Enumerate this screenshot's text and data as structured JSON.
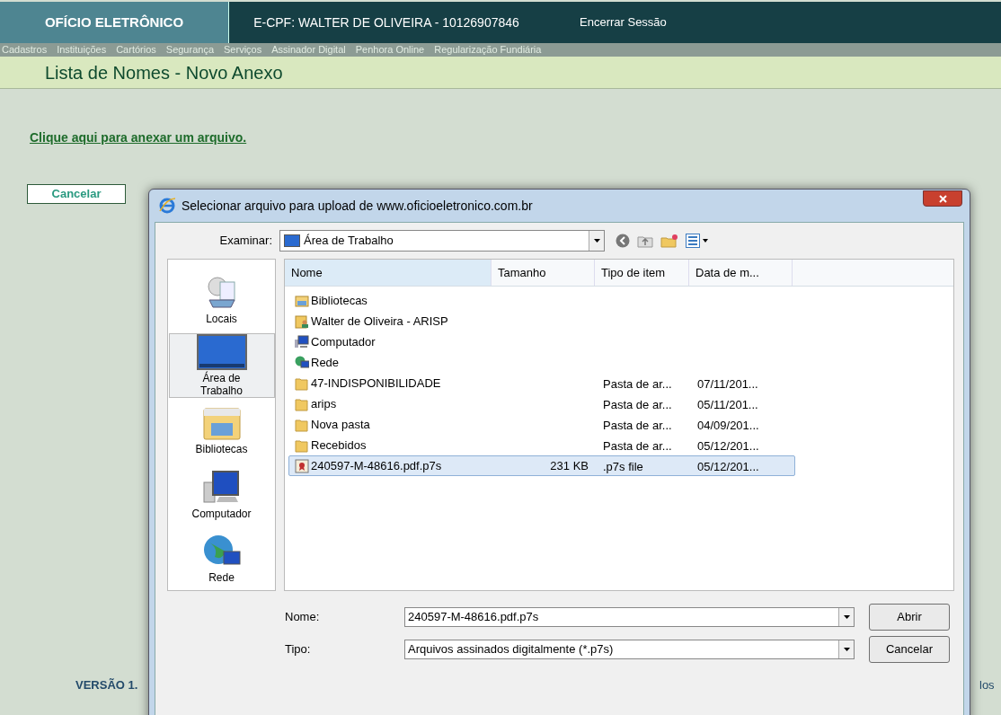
{
  "header": {
    "brand": "OFÍCIO ELETRÔNICO",
    "user": "E-CPF: WALTER DE OLIVEIRA - 10126907846",
    "logout": "Encerrar Sessão"
  },
  "menu": [
    "Cadastros",
    "Instituições",
    "Cartórios",
    "Segurança",
    "Serviços",
    "Assinador Digital",
    "Penhora Online",
    "Regularização Fundiária"
  ],
  "page_title": "Lista de Nomes - Novo Anexo",
  "attach_link": "Clique aqui para anexar um arquivo.",
  "cancel_button": "Cancelar",
  "footer": {
    "version": "VERSÃO 1.",
    "right_text": "los"
  },
  "dialog": {
    "title": "Selecionar arquivo para upload de www.oficioeletronico.com.br",
    "look_in_label": "Examinar:",
    "look_in_value": "Área de Trabalho",
    "places": [
      {
        "label": "Locais",
        "kind": "recent",
        "selected": false
      },
      {
        "label": "Área de Trabalho",
        "kind": "desktop",
        "selected": true
      },
      {
        "label": "Bibliotecas",
        "kind": "library",
        "selected": false
      },
      {
        "label": "Computador",
        "kind": "computer",
        "selected": false
      },
      {
        "label": "Rede",
        "kind": "network",
        "selected": false
      }
    ],
    "columns": [
      "Nome",
      "Tamanho",
      "Tipo de item",
      "Data de m..."
    ],
    "files": [
      {
        "name": "Bibliotecas",
        "kind": "library",
        "selected": false
      },
      {
        "name": "Walter de Oliveira - ARISP",
        "kind": "user",
        "selected": false
      },
      {
        "name": "Computador",
        "kind": "computer",
        "selected": false
      },
      {
        "name": "Rede",
        "kind": "network",
        "selected": false
      },
      {
        "name": "47-INDISPONIBILIDADE",
        "type": "Pasta de ar...",
        "date": "07/11/201...",
        "kind": "folder",
        "selected": false
      },
      {
        "name": "arips",
        "type": "Pasta de ar...",
        "date": "05/11/201...",
        "kind": "folder",
        "selected": false
      },
      {
        "name": "Nova pasta",
        "type": "Pasta de ar...",
        "date": "04/09/201...",
        "kind": "folder",
        "selected": false
      },
      {
        "name": "Recebidos",
        "type": "Pasta de ar...",
        "date": "05/12/201...",
        "kind": "folder",
        "selected": false
      },
      {
        "name": "240597-M-48616.pdf.p7s",
        "size": "231 KB",
        "type": ".p7s file",
        "date": "05/12/201...",
        "kind": "certificate",
        "selected": true
      }
    ],
    "filename_label": "Nome:",
    "filename_value": "240597-M-48616.pdf.p7s",
    "filetype_label": "Tipo:",
    "filetype_value": "Arquivos assinados digitalmente (*.p7s)",
    "buttons": [
      "Abrir",
      "Cancelar"
    ]
  }
}
